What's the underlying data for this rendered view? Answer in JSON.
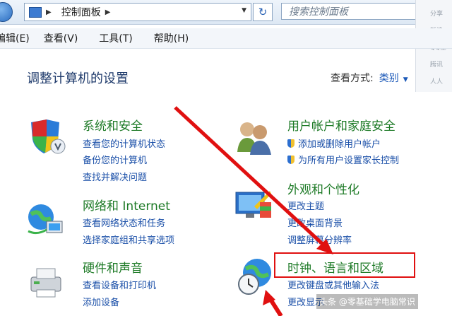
{
  "address": {
    "breadcrumb": "控制面板",
    "search_placeholder": "搜索控制面板"
  },
  "menu": [
    "编辑(E)",
    "查看(V)",
    "工具(T)",
    "帮助(H)"
  ],
  "heading": "调整计算机的设置",
  "view_mode": {
    "label": "查看方式:",
    "value": "类别"
  },
  "side_panel": [
    "分享",
    "新浪",
    "QQ空",
    "腾讯",
    "人人"
  ],
  "categories": [
    {
      "title": "系统和安全",
      "links": [
        "查看您的计算机状态",
        "备份您的计算机",
        "查找并解决问题"
      ]
    },
    {
      "title": "网络和 Internet",
      "links": [
        "查看网络状态和任务",
        "选择家庭组和共享选项"
      ]
    },
    {
      "title": "硬件和声音",
      "links": [
        "查看设备和打印机",
        "添加设备"
      ]
    },
    {
      "title": "用户帐户和家庭安全",
      "links": [
        "添加或删除用户帐户",
        "为所有用户设置家长控制"
      ]
    },
    {
      "title": "外观和个性化",
      "links": [
        "更改主题",
        "更改桌面背景",
        "调整屏幕分辨率"
      ]
    },
    {
      "title": "时钟、语言和区域",
      "links": [
        "更改键盘或其他输入法",
        "更改显示"
      ]
    }
  ],
  "watermark": "头条 @零基础学电脑常识",
  "colors": {
    "category_title": "#1d7a26",
    "link": "#1a4fa8",
    "annotation": "#e01010"
  }
}
